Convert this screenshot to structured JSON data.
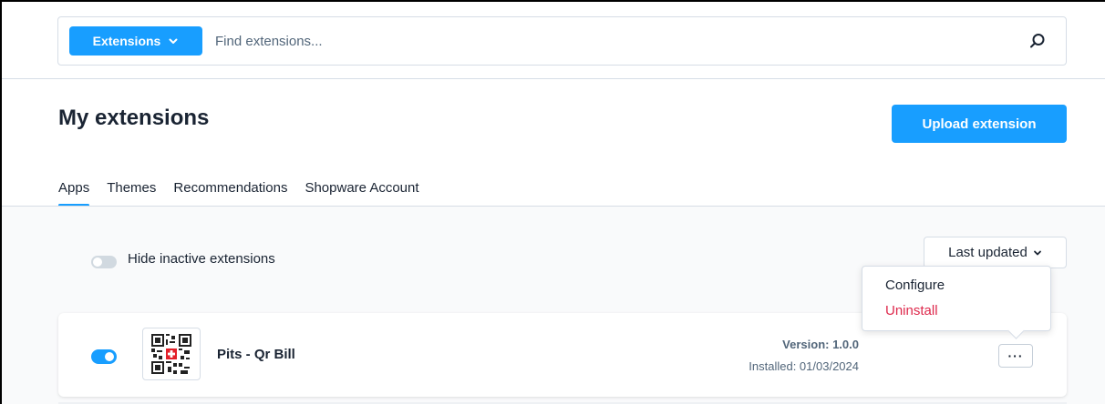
{
  "search": {
    "category_label": "Extensions",
    "placeholder": "Find extensions..."
  },
  "header": {
    "title": "My extensions",
    "upload_label": "Upload extension"
  },
  "tabs": [
    {
      "label": "Apps",
      "active": true
    },
    {
      "label": "Themes",
      "active": false
    },
    {
      "label": "Recommendations",
      "active": false
    },
    {
      "label": "Shopware Account",
      "active": false
    }
  ],
  "filters": {
    "hide_inactive_label": "Hide inactive extensions",
    "hide_inactive_enabled": false,
    "sort_label": "Last updated"
  },
  "extensions": [
    {
      "name": "Pits - Qr Bill",
      "active": true,
      "version": "Version: 1.0.0",
      "installed": "Installed: 01/03/2024",
      "icon": "qr-code-icon"
    }
  ],
  "context_menu": {
    "configure_label": "Configure",
    "uninstall_label": "Uninstall"
  },
  "colors": {
    "accent": "#189eff",
    "danger": "#de294c",
    "text": "#1a2433",
    "muted": "#52667a"
  }
}
